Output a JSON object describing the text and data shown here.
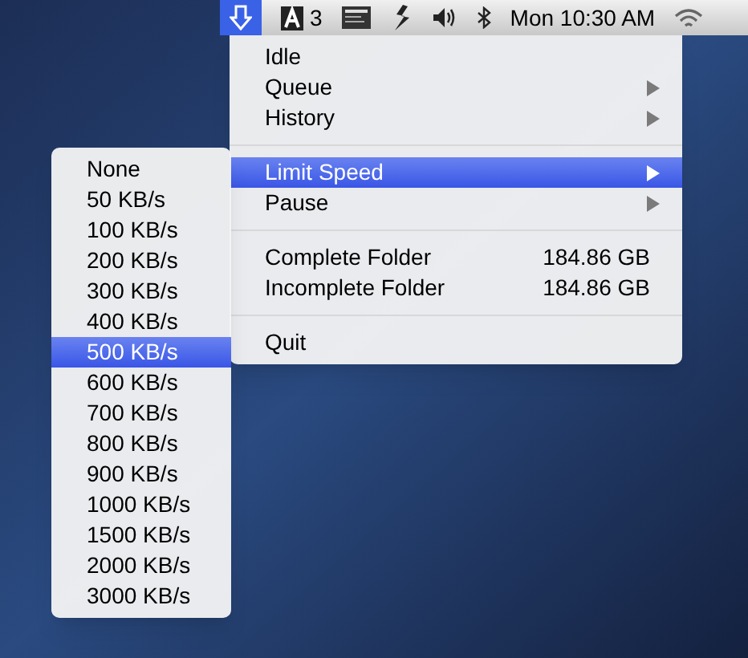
{
  "menu_bar": {
    "status_item_selected": true,
    "badge_count": "3",
    "clock": "Mon 10:30 AM"
  },
  "menu": [
    {
      "kind": "item",
      "label": "Idle",
      "has_submenu": false,
      "selected": false
    },
    {
      "kind": "item",
      "label": "Queue",
      "has_submenu": true,
      "selected": false
    },
    {
      "kind": "item",
      "label": "History",
      "has_submenu": true,
      "selected": false
    },
    {
      "kind": "separator"
    },
    {
      "kind": "item",
      "label": "Limit Speed",
      "has_submenu": true,
      "selected": true
    },
    {
      "kind": "item",
      "label": "Pause",
      "has_submenu": true,
      "selected": false
    },
    {
      "kind": "separator"
    },
    {
      "kind": "item",
      "label": "Complete Folder",
      "value": "184.86 GB",
      "has_submenu": false,
      "selected": false
    },
    {
      "kind": "item",
      "label": "Incomplete Folder",
      "value": "184.86 GB",
      "has_submenu": false,
      "selected": false
    },
    {
      "kind": "separator"
    },
    {
      "kind": "item",
      "label": "Quit",
      "has_submenu": false,
      "selected": false
    }
  ],
  "speed_submenu": [
    {
      "label": "None",
      "selected": false
    },
    {
      "label": "50 KB/s",
      "selected": false
    },
    {
      "label": "100 KB/s",
      "selected": false
    },
    {
      "label": "200 KB/s",
      "selected": false
    },
    {
      "label": "300 KB/s",
      "selected": false
    },
    {
      "label": "400 KB/s",
      "selected": false
    },
    {
      "label": "500 KB/s",
      "selected": true
    },
    {
      "label": "600 KB/s",
      "selected": false
    },
    {
      "label": "700 KB/s",
      "selected": false
    },
    {
      "label": "800 KB/s",
      "selected": false
    },
    {
      "label": "900 KB/s",
      "selected": false
    },
    {
      "label": "1000 KB/s",
      "selected": false
    },
    {
      "label": "1500 KB/s",
      "selected": false
    },
    {
      "label": "2000 KB/s",
      "selected": false
    },
    {
      "label": "3000 KB/s",
      "selected": false
    }
  ]
}
